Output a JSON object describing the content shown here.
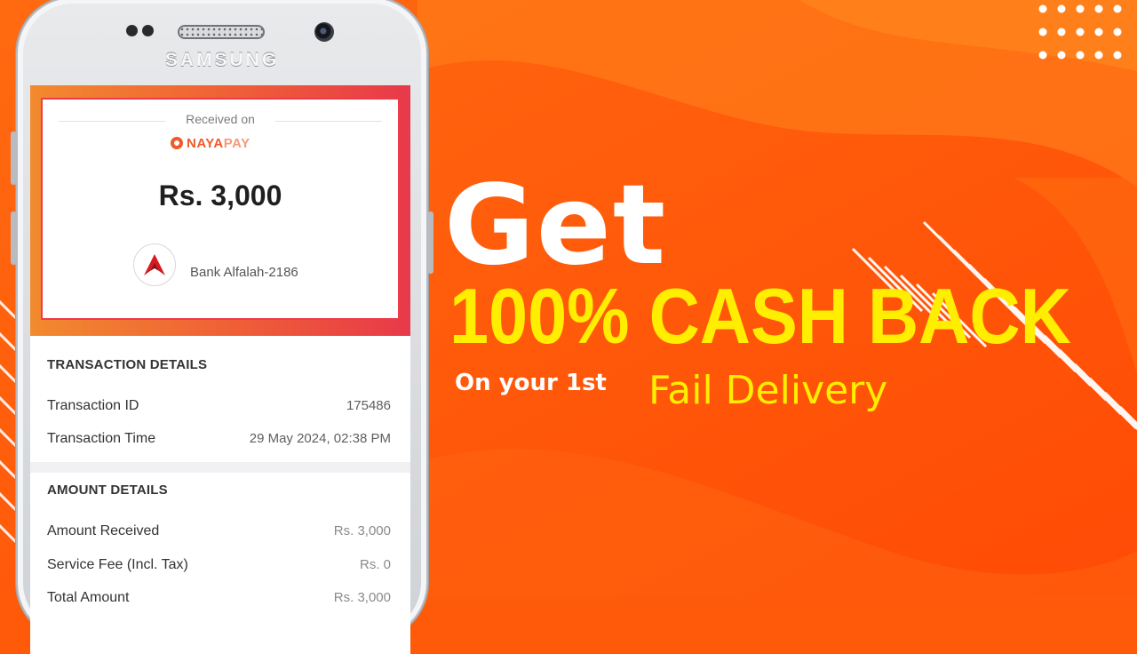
{
  "phone": {
    "brand": "SAMSUNG"
  },
  "receipt": {
    "received_on": "Received on",
    "wallet_name_a": "NAYA",
    "wallet_name_b": "PAY",
    "amount": "Rs. 3,000",
    "bank_name": "Bank Alfalah-2186"
  },
  "transaction_details": {
    "title": "TRANSACTION DETAILS",
    "rows": [
      {
        "label": "Transaction ID",
        "value": "175486"
      },
      {
        "label": "Transaction Time",
        "value": "29 May 2024, 02:38 PM"
      }
    ]
  },
  "amount_details": {
    "title": "AMOUNT DETAILS",
    "rows": [
      {
        "label": "Amount Received",
        "value": "Rs. 3,000"
      },
      {
        "label": "Service Fee (Incl. Tax)",
        "value": "Rs. 0"
      },
      {
        "label": "Total Amount",
        "value": "Rs. 3,000"
      }
    ]
  },
  "promo": {
    "headline": "Get",
    "offer": "100% CASH BACK",
    "sub_a": "On your 1st",
    "sub_b": "Fail Delivery"
  },
  "colors": {
    "background": "#ff5a0a",
    "offer_yellow": "#ffee00",
    "brand_orange": "#f05a28",
    "highlight_red": "#ef3b47"
  }
}
